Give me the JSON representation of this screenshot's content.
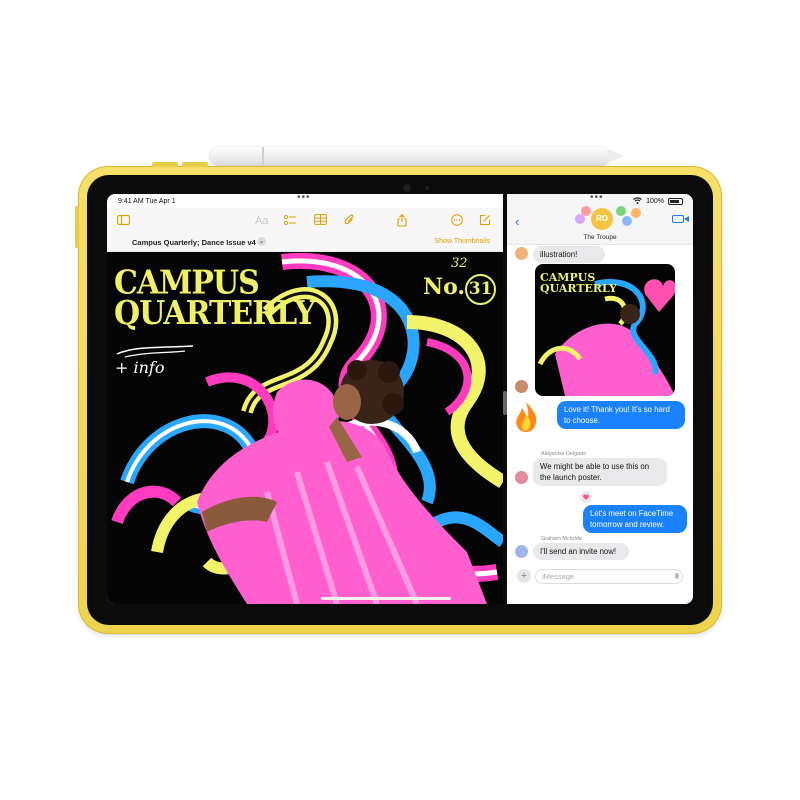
{
  "status_bar": {
    "time": "9:41 AM  Tue Apr 1",
    "battery": "100%",
    "multitask_dots_left": "•••",
    "multitask_dots_right": "•••"
  },
  "notes": {
    "document_title": "Campus Quarterly; Dance Issue v4",
    "show_thumbnails": "Show Thumbnails",
    "toolbar_icons": [
      "sidebar-icon",
      "text-format-icon",
      "checklist-icon",
      "table-icon",
      "attachment-icon",
      "share-icon",
      "more-icon",
      "compose-icon"
    ],
    "text_format_label": "Aa",
    "poster": {
      "title_line1": "CAMPUS",
      "title_line2": "QUARTERLY",
      "issue_prefix": "No.",
      "issue_number": "31",
      "volume": "32",
      "handwritten": "+ info"
    }
  },
  "messages": {
    "group_initials": "RO",
    "group_name": "The Troupe",
    "conversation": [
      {
        "type": "in",
        "text": "illustration!"
      },
      {
        "type": "out",
        "text": "Love it! Thank you! It's so hard to choose."
      },
      {
        "type": "in",
        "sender": "Alejandra Delgado",
        "text": "We might be able to use this on the launch poster."
      },
      {
        "type": "out",
        "text": "Let's meet on FaceTime tomorrow and review."
      },
      {
        "type": "in",
        "sender": "Graham Mcbride",
        "text": "I'll send an invite now!"
      }
    ],
    "shared_image_title": "CAMPUS QUARTERLY",
    "input_placeholder": "iMessage",
    "colors": {
      "accent": "#1a82ff",
      "incoming": "#e9e9eb"
    }
  },
  "device": {
    "body_color": "#f2d755",
    "poster_yellow": "#eef06a"
  }
}
